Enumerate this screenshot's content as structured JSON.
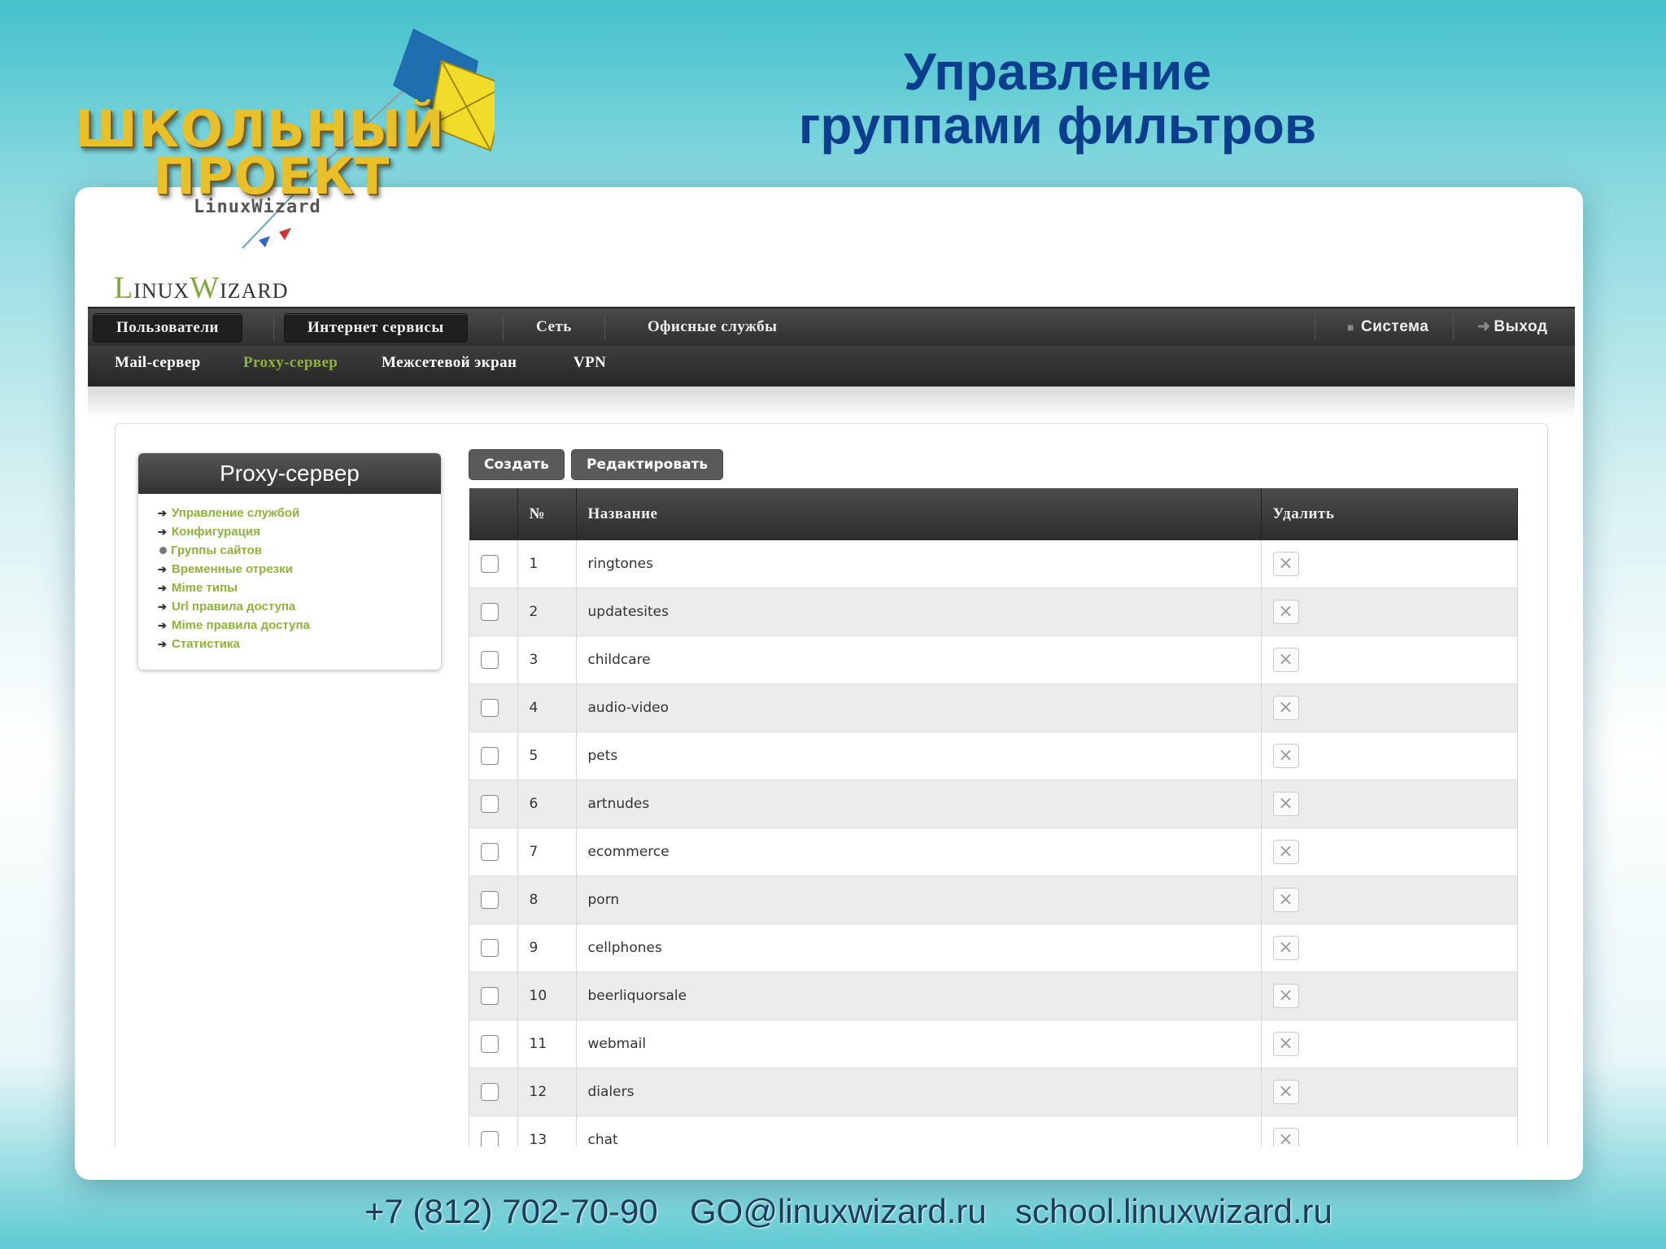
{
  "slide": {
    "title_line1": "Управление",
    "title_line2": "группами фильтров",
    "logo_line1": "ШКОЛЬНЫЙ",
    "logo_line2": "ПРОЕКТ",
    "logo_line3": "LinuxWizard",
    "contacts": [
      "+7 (812) 702-70-90",
      "GO@linuxwizard.ru",
      "school.linuxwizard.ru"
    ]
  },
  "app": {
    "logo_l": "L",
    "logo_inux": "INUX",
    "logo_w": "W",
    "logo_izard": "IZARD",
    "topnav": [
      "Пользователи",
      "Интернет сервисы",
      "Сеть",
      "Офисные службы"
    ],
    "topnav_right": {
      "system": "Система",
      "logout": "Выход"
    },
    "subnav": [
      "Mail-сервер",
      "Proxy-сервер",
      "Межсетевой экран",
      "VPN"
    ],
    "subnav_active": "Proxy-сервер"
  },
  "sidebar": {
    "title": "Proxy-сервер",
    "items": [
      {
        "label": "Управление службой",
        "active": false
      },
      {
        "label": "Конфигурация",
        "active": false
      },
      {
        "label": "Группы сайтов",
        "active": true
      },
      {
        "label": "Временные отрезки",
        "active": false
      },
      {
        "label": "Mime типы",
        "active": false
      },
      {
        "label": "Url правила доступа",
        "active": false
      },
      {
        "label": "Mime правила доступа",
        "active": false
      },
      {
        "label": "Статистика",
        "active": false
      }
    ]
  },
  "toolbar": {
    "create": "Создать",
    "edit": "Редактировать"
  },
  "table": {
    "headers": [
      "",
      "№",
      "Название",
      "Удалить"
    ],
    "rows": [
      {
        "num": "1",
        "name": "ringtones"
      },
      {
        "num": "2",
        "name": "updatesites"
      },
      {
        "num": "3",
        "name": "childcare"
      },
      {
        "num": "4",
        "name": "audio-video"
      },
      {
        "num": "5",
        "name": "pets"
      },
      {
        "num": "6",
        "name": "artnudes"
      },
      {
        "num": "7",
        "name": "ecommerce"
      },
      {
        "num": "8",
        "name": "porn"
      },
      {
        "num": "9",
        "name": "cellphones"
      },
      {
        "num": "10",
        "name": "beerliquorsale"
      },
      {
        "num": "11",
        "name": "webmail"
      },
      {
        "num": "12",
        "name": "dialers"
      },
      {
        "num": "13",
        "name": "chat"
      }
    ]
  }
}
